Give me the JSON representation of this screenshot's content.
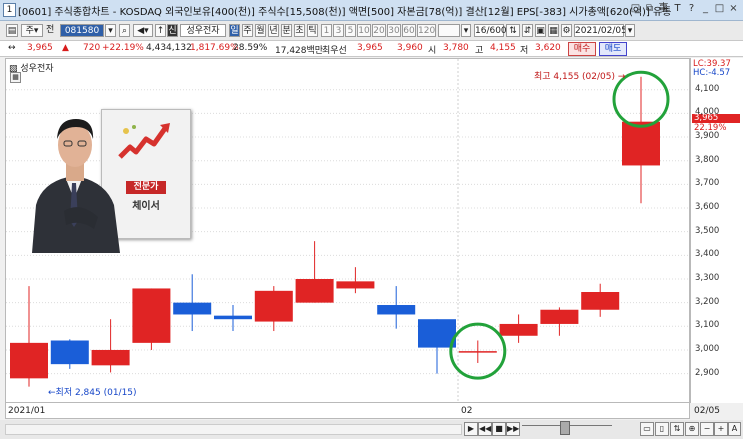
{
  "window": {
    "number": "1",
    "title": "[0601] 주식종합차트 - KOSDAQ 외국인보유[400(천)] 주식수[15,508(천)] 액면[500] 자본금[78(억)] 결산[12월] EPS[-383] 시가총액[620(억)] 유통",
    "buttons": [
      "□",
      "⧉",
      "事",
      "T",
      "?",
      "_",
      "□",
      "×"
    ]
  },
  "toolbar": {
    "period_mode": "전",
    "code": "081580",
    "market_tag": "신",
    "stock_name": "성우전자",
    "period_buttons": [
      "일",
      "주",
      "월",
      "년",
      "분",
      "초",
      "틱"
    ],
    "active_period": "일",
    "intervals": [
      "1",
      "3",
      "5",
      "10",
      "20",
      "30",
      "60",
      "120"
    ],
    "count": "16/600",
    "date": "2021/02/05"
  },
  "quote": {
    "price": "3,965",
    "arrow": "▲",
    "change": "720",
    "change_pct": "+22.19%",
    "volume": "4,434,132",
    "volume_pct": "1,817.69%",
    "turnover": "28.59%",
    "amount": "17,428백만",
    "best_ask_label": "최우선",
    "best_ask": "3,965",
    "best_bid": "3,960",
    "open_label": "시",
    "open": "3,780",
    "high_label": "고",
    "high": "4,155",
    "low_label": "저",
    "low": "3,620",
    "buy_label": "매수",
    "sell_label": "매도"
  },
  "chart_header": {
    "name": "성우전자"
  },
  "overlay_card": {
    "badge": "전문가",
    "name": "체이서"
  },
  "annotations": {
    "high": "최고 4,155 (02/05) →",
    "low": "←최저 2,845 (01/15)"
  },
  "y_axis_labels": {
    "lc": "LC:39.37",
    "hc": "HC:-4.57",
    "current_price": "3,965",
    "current_pct": "22.19%"
  },
  "chart_data": {
    "type": "candlestick",
    "ylim": [
      2780,
      4230
    ],
    "yticks": [
      2900,
      3000,
      3100,
      3200,
      3300,
      3400,
      3500,
      3600,
      3700,
      3800,
      3900,
      4000,
      4100
    ],
    "ytick_labels": [
      "2,900",
      "3,000",
      "3,100",
      "3,200",
      "3,300",
      "3,400",
      "3,500",
      "3,600",
      "3,700",
      "3,800",
      "3,900",
      "4,000",
      "4,100"
    ],
    "x_labels": [
      "2021/01",
      "02",
      "02/05"
    ],
    "candles": [
      {
        "open": 2880,
        "high": 3270,
        "low": 2845,
        "close": 3030,
        "color": "red"
      },
      {
        "open": 3040,
        "high": 3045,
        "low": 2920,
        "close": 2940,
        "color": "blue"
      },
      {
        "open": 2935,
        "high": 3130,
        "low": 2905,
        "close": 3000,
        "color": "red"
      },
      {
        "open": 3030,
        "high": 3260,
        "low": 3000,
        "close": 3260,
        "color": "red"
      },
      {
        "open": 3200,
        "high": 3320,
        "low": 3080,
        "close": 3150,
        "color": "blue"
      },
      {
        "open": 3145,
        "high": 3190,
        "low": 3080,
        "close": 3130,
        "color": "blue"
      },
      {
        "open": 3120,
        "high": 3270,
        "low": 3080,
        "close": 3250,
        "color": "red"
      },
      {
        "open": 3200,
        "high": 3460,
        "low": 3200,
        "close": 3300,
        "color": "red"
      },
      {
        "open": 3260,
        "high": 3350,
        "low": 3240,
        "close": 3290,
        "color": "red"
      },
      {
        "open": 3190,
        "high": 3270,
        "low": 3090,
        "close": 3150,
        "color": "blue"
      },
      {
        "open": 3130,
        "high": 3130,
        "low": 2900,
        "close": 3010,
        "color": "blue"
      },
      {
        "open": 2995,
        "high": 3040,
        "low": 2945,
        "close": 2995,
        "color": "red"
      },
      {
        "open": 3060,
        "high": 3150,
        "low": 3030,
        "close": 3110,
        "color": "red"
      },
      {
        "open": 3110,
        "high": 3180,
        "low": 3060,
        "close": 3170,
        "color": "red"
      },
      {
        "open": 3170,
        "high": 3280,
        "low": 3140,
        "close": 3245,
        "color": "red"
      },
      {
        "open": 3780,
        "high": 4155,
        "low": 3620,
        "close": 3965,
        "color": "red"
      }
    ],
    "highlighted_candles": [
      11,
      15
    ]
  },
  "colors": {
    "up": "#e02424",
    "down": "#1a5ed8",
    "highlight": "#22a23a",
    "annotation": "#c01818"
  }
}
